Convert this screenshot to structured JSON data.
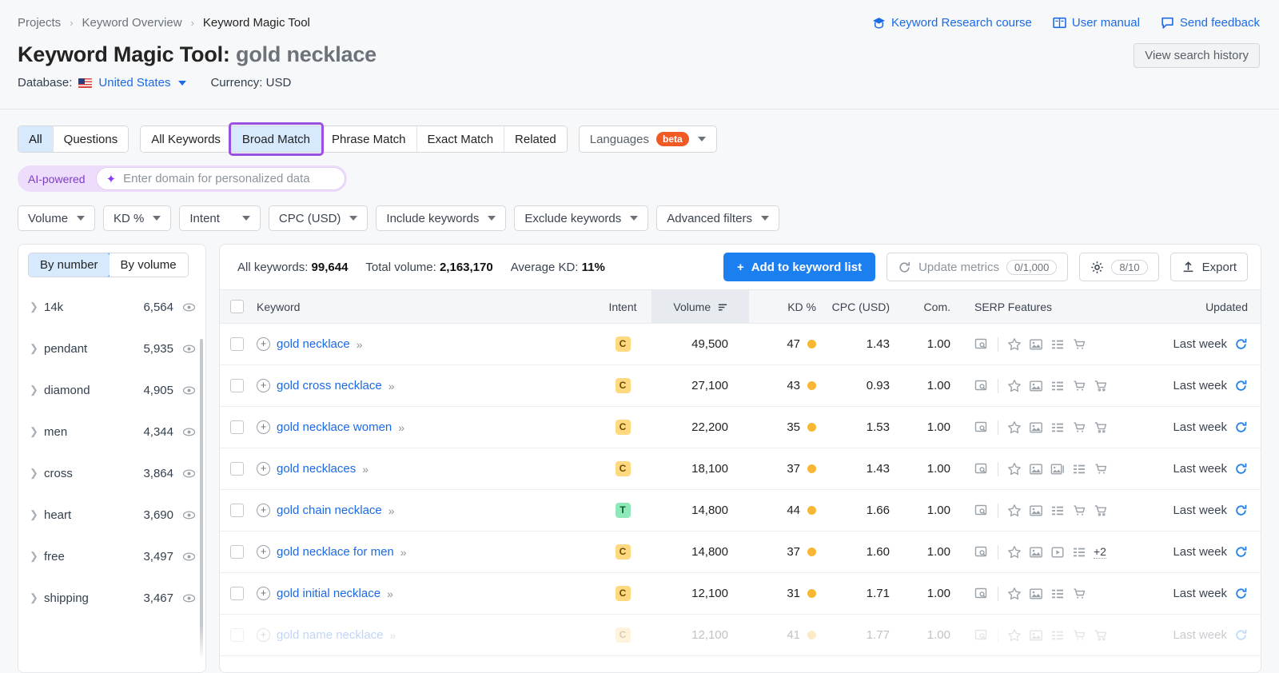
{
  "breadcrumb": {
    "projects": "Projects",
    "keyword_overview": "Keyword Overview",
    "current": "Keyword Magic Tool",
    "separator": "›"
  },
  "header": {
    "title_prefix": "Keyword Magic Tool:",
    "query": "gold necklace",
    "database_label": "Database:",
    "database_value": "United States",
    "currency_label": "Currency: USD",
    "view_history": "View search history",
    "links": [
      {
        "label": "Keyword Research course",
        "icon": "graduation-cap-icon"
      },
      {
        "label": "User manual",
        "icon": "book-icon"
      },
      {
        "label": "Send feedback",
        "icon": "speech-bubble-icon"
      }
    ]
  },
  "tabs": {
    "group_a": [
      {
        "label": "All",
        "active": true
      },
      {
        "label": "Questions",
        "active": false
      }
    ],
    "group_b": [
      {
        "label": "All Keywords",
        "active": false
      },
      {
        "label": "Broad Match",
        "active": true,
        "outlined": true
      },
      {
        "label": "Phrase Match",
        "active": false
      },
      {
        "label": "Exact Match",
        "active": false
      },
      {
        "label": "Related",
        "active": false
      }
    ],
    "languages": {
      "label": "Languages",
      "badge": "beta"
    }
  },
  "ai_bar": {
    "tag": "AI-powered",
    "placeholder": "Enter domain for personalized data",
    "icon": "sparkle-icon"
  },
  "filters": [
    {
      "label": "Volume"
    },
    {
      "label": "KD %"
    },
    {
      "label": "Intent"
    },
    {
      "label": "CPC (USD)"
    },
    {
      "label": "Include keywords"
    },
    {
      "label": "Exclude keywords"
    },
    {
      "label": "Advanced filters"
    }
  ],
  "sidebar": {
    "toggle": [
      {
        "label": "By number",
        "on": true
      },
      {
        "label": "By volume",
        "on": false
      }
    ],
    "items": [
      {
        "name": "14k",
        "count": "6,564"
      },
      {
        "name": "pendant",
        "count": "5,935"
      },
      {
        "name": "diamond",
        "count": "4,905"
      },
      {
        "name": "men",
        "count": "4,344"
      },
      {
        "name": "cross",
        "count": "3,864"
      },
      {
        "name": "heart",
        "count": "3,690"
      },
      {
        "name": "free",
        "count": "3,497"
      },
      {
        "name": "shipping",
        "count": "3,467"
      }
    ]
  },
  "toolbar": {
    "all_keywords_label": "All keywords:",
    "all_keywords_value": "99,644",
    "total_volume_label": "Total volume:",
    "total_volume_value": "2,163,170",
    "average_kd_label": "Average KD:",
    "average_kd_value": "11%",
    "add_to_list": "Add to keyword list",
    "update_metrics": "Update metrics",
    "update_metrics_count": "0/1,000",
    "settings_count": "8/10",
    "export": "Export"
  },
  "table": {
    "columns": [
      "Keyword",
      "Intent",
      "Volume",
      "KD %",
      "CPC (USD)",
      "Com.",
      "SERP Features",
      "Updated"
    ],
    "sorted_column": "Volume",
    "rows": [
      {
        "keyword": "gold necklace",
        "intent": "C",
        "volume": "49,500",
        "kd": "47",
        "cpc": "1.43",
        "com": "1.00",
        "serp": [
          "featured-snippet-icon",
          "reviews-icon",
          "image-icon",
          "sitelinks-icon",
          "shopping-icon"
        ],
        "extra": "",
        "updated": "Last week"
      },
      {
        "keyword": "gold cross necklace",
        "intent": "C",
        "volume": "27,100",
        "kd": "43",
        "cpc": "0.93",
        "com": "1.00",
        "serp": [
          "featured-snippet-icon",
          "reviews-icon",
          "image-icon",
          "sitelinks-icon",
          "shopping-icon",
          "cart-icon"
        ],
        "extra": "",
        "updated": "Last week"
      },
      {
        "keyword": "gold necklace women",
        "intent": "C",
        "volume": "22,200",
        "kd": "35",
        "cpc": "1.53",
        "com": "1.00",
        "serp": [
          "featured-snippet-icon",
          "reviews-icon",
          "image-icon",
          "sitelinks-icon",
          "shopping-icon",
          "cart-icon"
        ],
        "extra": "",
        "updated": "Last week"
      },
      {
        "keyword": "gold necklaces",
        "intent": "C",
        "volume": "18,100",
        "kd": "37",
        "cpc": "1.43",
        "com": "1.00",
        "serp": [
          "featured-snippet-icon",
          "reviews-icon",
          "image-icon",
          "image-pack-icon",
          "sitelinks-icon",
          "shopping-icon"
        ],
        "extra": "",
        "updated": "Last week"
      },
      {
        "keyword": "gold chain necklace",
        "intent": "T",
        "volume": "14,800",
        "kd": "44",
        "cpc": "1.66",
        "com": "1.00",
        "serp": [
          "featured-snippet-icon",
          "reviews-icon",
          "image-icon",
          "sitelinks-icon",
          "shopping-icon",
          "cart-icon"
        ],
        "extra": "",
        "updated": "Last week"
      },
      {
        "keyword": "gold necklace for men",
        "intent": "C",
        "volume": "14,800",
        "kd": "37",
        "cpc": "1.60",
        "com": "1.00",
        "serp": [
          "featured-snippet-icon",
          "reviews-icon",
          "image-icon",
          "video-icon",
          "sitelinks-icon"
        ],
        "extra": "+2",
        "updated": "Last week"
      },
      {
        "keyword": "gold initial necklace",
        "intent": "C",
        "volume": "12,100",
        "kd": "31",
        "cpc": "1.71",
        "com": "1.00",
        "serp": [
          "featured-snippet-icon",
          "reviews-icon",
          "image-icon",
          "sitelinks-icon",
          "shopping-icon"
        ],
        "extra": "",
        "updated": "Last week"
      },
      {
        "keyword": "gold name necklace",
        "intent": "C",
        "volume": "12,100",
        "kd": "41",
        "cpc": "1.77",
        "com": "1.00",
        "serp": [
          "featured-snippet-icon",
          "reviews-icon",
          "image-icon",
          "sitelinks-icon",
          "shopping-icon",
          "cart-icon"
        ],
        "extra": "",
        "updated": "Last week",
        "faded": true
      }
    ]
  },
  "colors": {
    "accent_blue": "#1c7ff0",
    "link_blue": "#1c6ae4",
    "purple_outline": "#9b51e0",
    "intent_c": "#ffd980",
    "intent_t": "#8fe8b8",
    "kd_dot": "#f7b733",
    "beta_orange": "#f15a24"
  }
}
